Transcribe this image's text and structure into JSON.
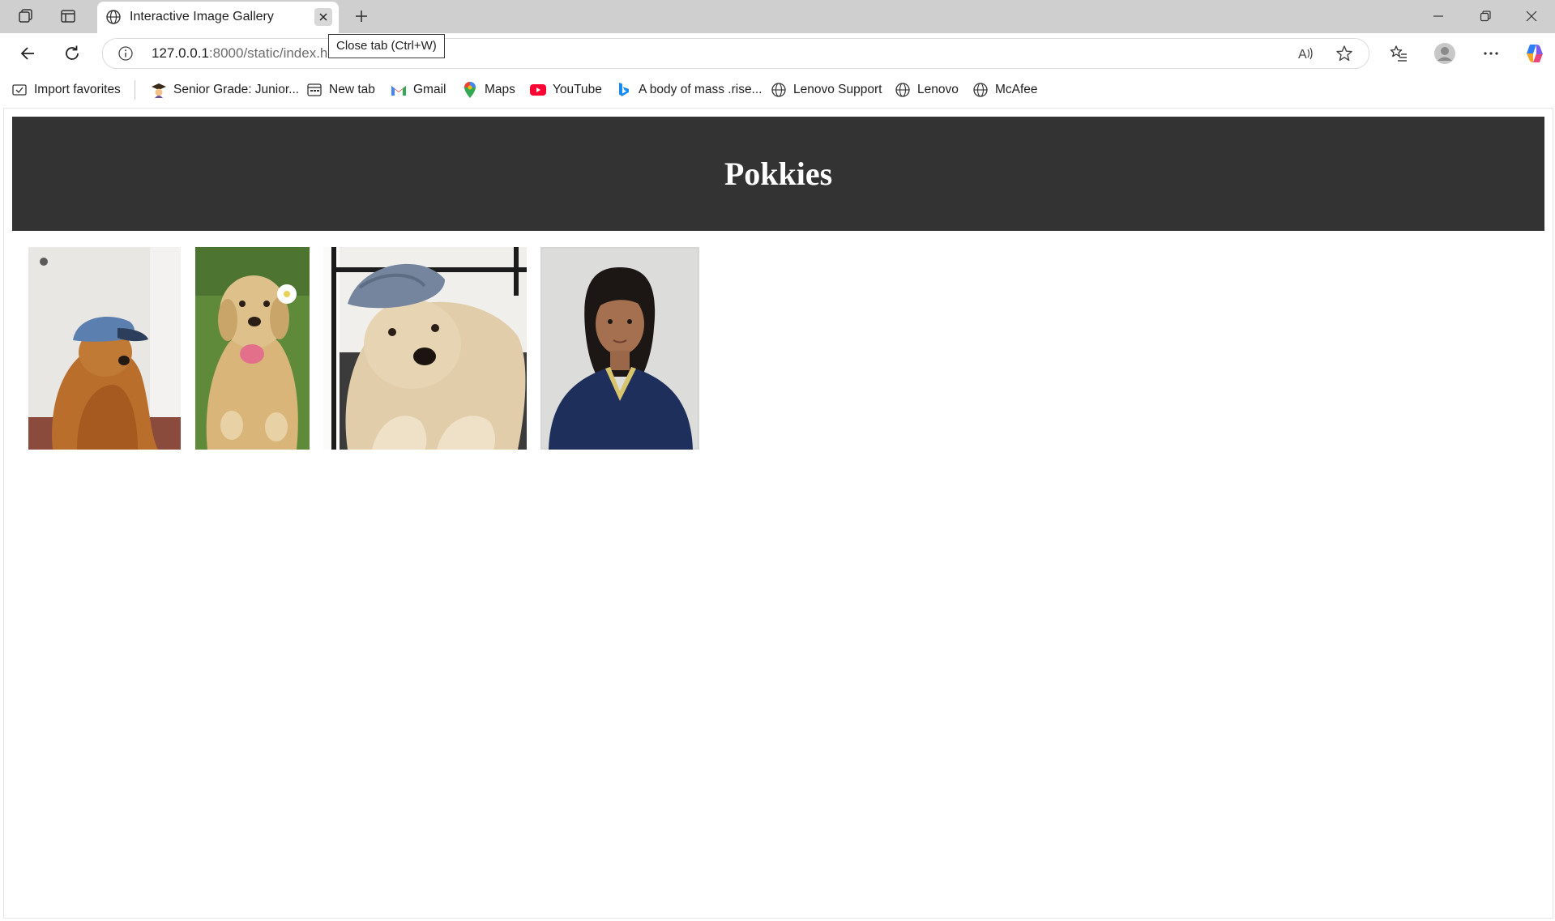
{
  "browser": {
    "tab": {
      "title": "Interactive Image Gallery"
    },
    "tooltip": "Close tab (Ctrl+W)",
    "address": {
      "host": "127.0.0.1",
      "path": ":8000/static/index.h"
    }
  },
  "favorites": [
    {
      "label": "Import favorites",
      "icon": "import-favorites-icon"
    },
    {
      "label": "Senior Grade: Junior...",
      "icon": "graduate-icon"
    },
    {
      "label": "New tab",
      "icon": "new-tab-icon"
    },
    {
      "label": "Gmail",
      "icon": "gmail-icon"
    },
    {
      "label": "Maps",
      "icon": "maps-pin-icon"
    },
    {
      "label": "YouTube",
      "icon": "youtube-icon"
    },
    {
      "label": "A body of mass .rise...",
      "icon": "bing-icon"
    },
    {
      "label": "Lenovo Support",
      "icon": "globe-icon"
    },
    {
      "label": "Lenovo",
      "icon": "globe-icon"
    },
    {
      "label": "McAfee",
      "icon": "globe-icon"
    }
  ],
  "page": {
    "title": "Pokkies",
    "header_bg": "#333333",
    "gallery": [
      {
        "description": "golden retriever wearing blue cap"
      },
      {
        "description": "golden retriever with flower on grass"
      },
      {
        "description": "golden retriever lying with cap"
      },
      {
        "description": "portrait photo"
      }
    ]
  }
}
